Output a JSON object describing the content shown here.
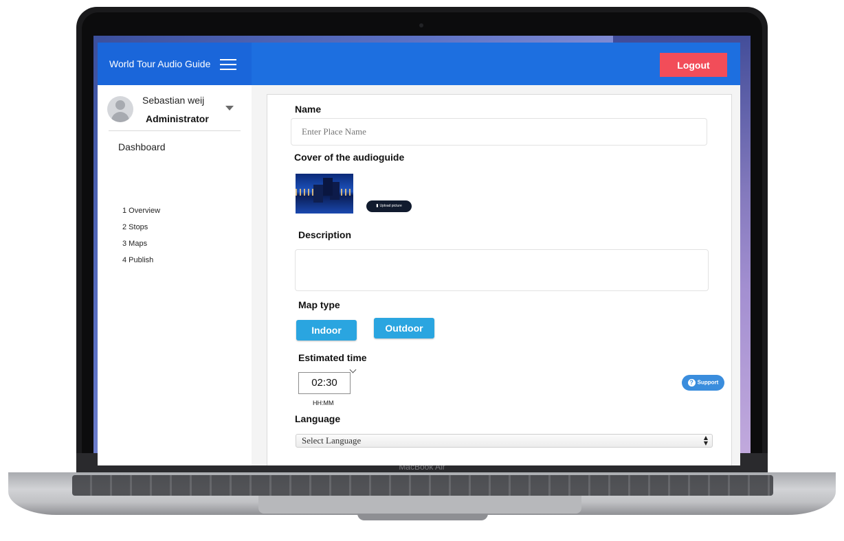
{
  "device": {
    "model_label": "MacBook Air"
  },
  "header": {
    "brand_title": "World Tour Audio Guide",
    "menu_icon": "hamburger-menu-icon",
    "logout_label": "Logout",
    "colors": {
      "header_bg": "#1d6fe0",
      "logout_bg": "#f24d59"
    }
  },
  "sidebar": {
    "user": {
      "name": "Sebastian weij",
      "role": "Administrator",
      "avatar_icon": "user-avatar-icon",
      "dropdown_icon": "caret-down-icon"
    },
    "section_title": "Dashboard",
    "items": [
      {
        "label": "1 Overview"
      },
      {
        "label": "2 Stops"
      },
      {
        "label": "3 Maps"
      },
      {
        "label": "4 Publish"
      }
    ]
  },
  "form": {
    "name": {
      "label": "Name",
      "placeholder": "Enter Place Name",
      "value": ""
    },
    "cover": {
      "label": "Cover of the audioguide",
      "image_icon": "city-skyline-image",
      "upload_label": "Upload picture",
      "upload_icon": "file-icon"
    },
    "description": {
      "label": "Description",
      "value": ""
    },
    "map_type": {
      "label": "Map type",
      "options": [
        "Indoor",
        "Outdoor"
      ]
    },
    "estimated_time": {
      "label": "Estimated time",
      "value": "02:30",
      "unit": "HH:MM",
      "chevron_icon": "chevron-down-icon"
    },
    "language": {
      "label": "Language",
      "selected": "Select Language",
      "arrows_icon": "select-arrows-icon"
    },
    "support": {
      "label": "Support",
      "icon": "question-circle-icon"
    },
    "colors": {
      "button_blue": "#2aa5e0",
      "support_blue": "#3a8ddd"
    }
  }
}
